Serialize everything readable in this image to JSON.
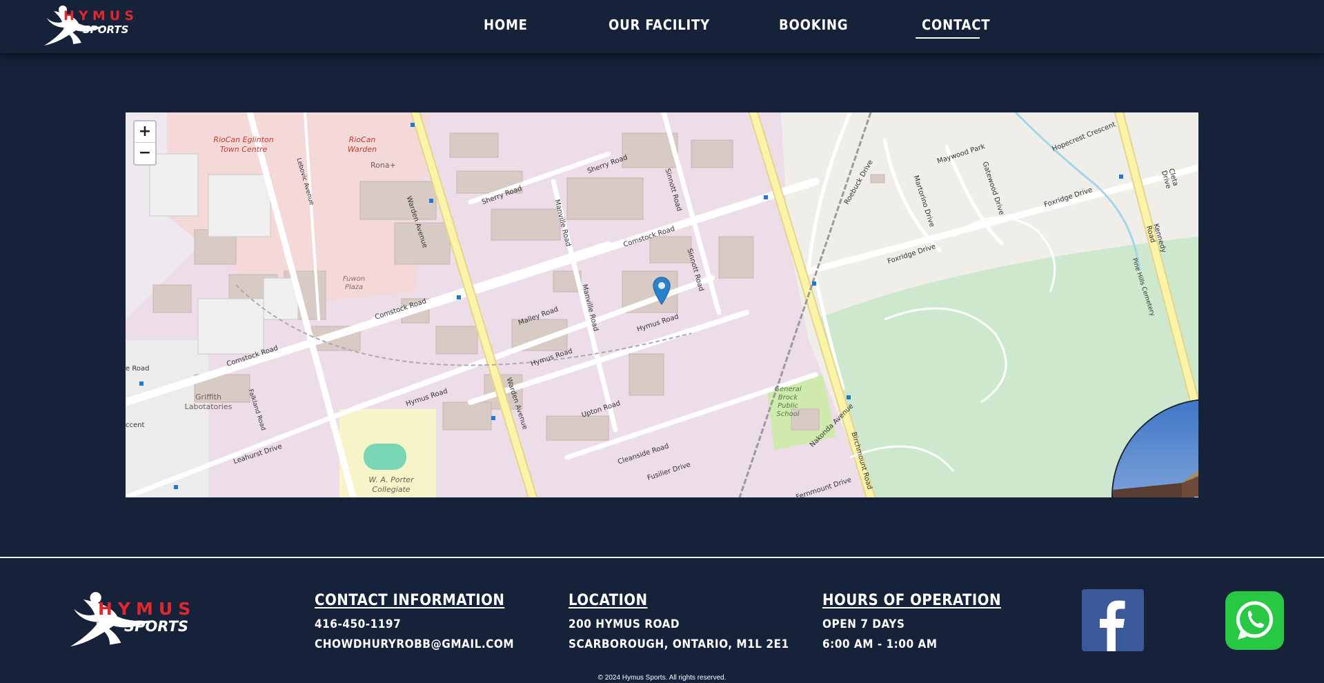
{
  "brand": {
    "name": "HYMUS",
    "sub": "SPORTS",
    "red": "#e0262e"
  },
  "nav": [
    {
      "label": "HOME"
    },
    {
      "label": "OUR FACILITY"
    },
    {
      "label": "BOOKING"
    },
    {
      "label": "CONTACT",
      "active": true
    }
  ],
  "map": {
    "zoom_in": "+",
    "zoom_out": "−",
    "labels": {
      "riocan_eglinton": "RioCan Eglinton Town Centre",
      "riocan_warden": "RioCan Warden",
      "rona": "Rona+",
      "fuwon": "Fuwon Plaza",
      "griffith": "Griffith Labotatories",
      "wa_porter": "W. A. Porter Collegiate",
      "general_brock": "General Brock Public School",
      "sherry_road": "Sherry Road",
      "comstock_road": "Comstock Road",
      "malley_road": "Malley Road",
      "hymus_road": "Hymus Road",
      "upton_road": "Upton Road",
      "warden_avenue": "Warden Avenue",
      "manville_road": "Manville Road",
      "sinnott_road": "Sinnott Road",
      "birchmount_road": "Birchmount Road",
      "kennedy_road": "Kennedy Road",
      "foxridge_drive": "Foxridge Drive",
      "maywood_park": "Maywood Park",
      "martorino_drive": "Martorino Drive",
      "gatewood_drive": "Gatewood Drive",
      "roebuck_drive": "Roebuck Drive",
      "hopecrest_crescent": "Hopecrest Crescent",
      "cleta_drive": "Cleta Drive",
      "leahurst_drive": "Leahurst Drive",
      "falkland_road": "Falkland Road",
      "cleanside_road": "Cleanside Road",
      "fusilier_drive": "Fusilier Drive",
      "nakonda_avenue": "Nakonda Avenue",
      "fernmount_drive": "Fernmount Drive",
      "pine_hills_cemetery": "Pine Hills Cemetery",
      "lebovic_avenue": "Lebovic Avenue",
      "ccent": "ccent",
      "e_road": "e Road"
    },
    "marker_color": "#2b82cb"
  },
  "footer": {
    "contact": {
      "heading": "CONTACT INFORMATION",
      "phone": "416-450-1197",
      "email": "CHOWDHURYROBB@GMAIL.COM"
    },
    "location": {
      "heading": "LOCATION",
      "line1": "200 HYMUS ROAD",
      "line2": "SCARBOROUGH, ONTARIO, M1L 2E1"
    },
    "hours": {
      "heading": "HOURS OF OPERATION",
      "line1": "OPEN 7 DAYS",
      "line2": "6:00 AM - 1:00 AM"
    },
    "copyright": "© 2024 Hymus Sports. All rights reserved.",
    "social": [
      {
        "icon": "facebook-icon",
        "color": "#3b5998"
      },
      {
        "icon": "whatsapp-icon",
        "color": "#28c744"
      }
    ]
  }
}
